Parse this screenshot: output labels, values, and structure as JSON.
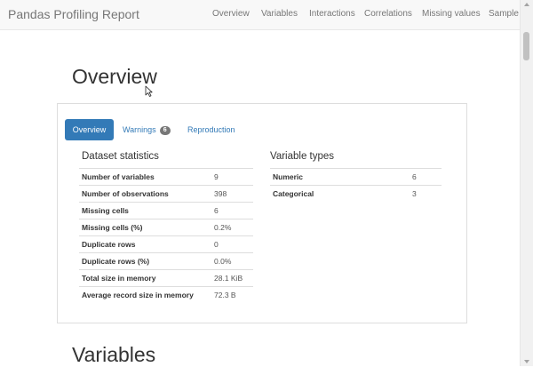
{
  "navbar": {
    "brand": "Pandas Profiling Report",
    "links": [
      "Overview",
      "Variables",
      "Interactions",
      "Correlations",
      "Missing values",
      "Sample"
    ]
  },
  "headings": {
    "overview": "Overview",
    "variables": "Variables"
  },
  "tabs": {
    "overview": "Overview",
    "warnings": "Warnings",
    "warnings_count": "6",
    "reproduction": "Reproduction"
  },
  "dataset_statistics": {
    "title": "Dataset statistics",
    "rows": [
      {
        "label": "Number of variables",
        "value": "9"
      },
      {
        "label": "Number of observations",
        "value": "398"
      },
      {
        "label": "Missing cells",
        "value": "6"
      },
      {
        "label": "Missing cells (%)",
        "value": "0.2%"
      },
      {
        "label": "Duplicate rows",
        "value": "0"
      },
      {
        "label": "Duplicate rows (%)",
        "value": "0.0%"
      },
      {
        "label": "Total size in memory",
        "value": "28.1 KiB"
      },
      {
        "label": "Average record size in memory",
        "value": "72.3 B"
      }
    ]
  },
  "variable_types": {
    "title": "Variable types",
    "rows": [
      {
        "label": "Numeric",
        "value": "6"
      },
      {
        "label": "Categorical",
        "value": "3"
      }
    ]
  },
  "colors": {
    "accent": "#337ab7",
    "badge": "#777777",
    "navbar_bg": "#f8f8f8"
  }
}
